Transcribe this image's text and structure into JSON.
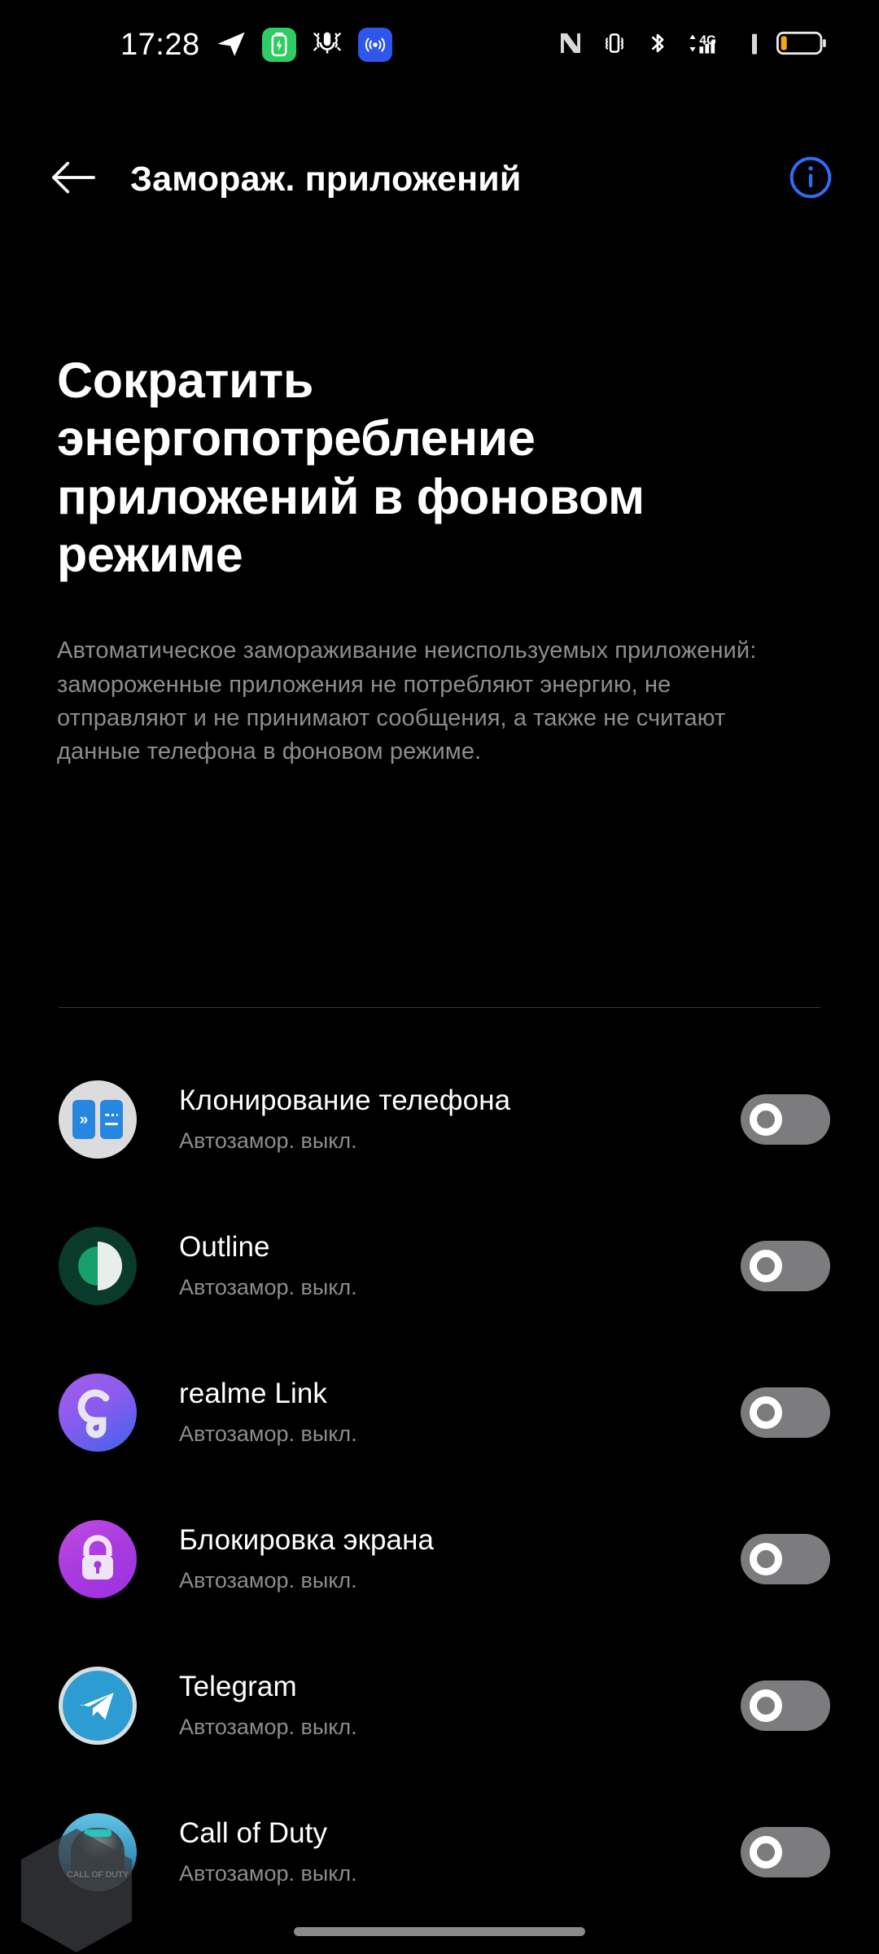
{
  "status_bar": {
    "clock": "17:28",
    "left_icons": [
      {
        "name": "telegram-icon",
        "label": "Telegram"
      },
      {
        "name": "battery-saver-icon",
        "label": "Battery saver",
        "color": "#2ecc63"
      },
      {
        "name": "mic-bug-icon",
        "label": "Microphone in use"
      },
      {
        "name": "broadcast-icon",
        "label": "Broadcast",
        "color": "#2f56ea"
      }
    ],
    "right_icons": [
      {
        "name": "nfc-icon",
        "label": "NFC"
      },
      {
        "name": "vibrate-icon",
        "label": "Vibrate"
      },
      {
        "name": "bluetooth-icon",
        "label": "Bluetooth"
      },
      {
        "name": "mobile-data-icon",
        "label": "4G"
      },
      {
        "name": "signal-bars-icon",
        "label": "Signal"
      },
      {
        "name": "battery-icon",
        "label": "Battery low",
        "color": "#f0a81e"
      }
    ],
    "network_type": "4G"
  },
  "app_bar": {
    "back_icon": "arrow-left-icon",
    "title": "Замораж. приложений",
    "info_icon": "info-circle-icon",
    "info_color": "#2f6df6"
  },
  "hero": {
    "title": "Сократить энергопотребление приложений в фоновом режиме",
    "description": "Автоматическое замораживание неиспользуемых приложений: замороженные приложения не потребляют энергию, не отправляют и не принимают сообщения, а также не считают данные телефона в фоновом режиме."
  },
  "apps": [
    {
      "name": "Клонирование телефона",
      "status": "Автозамор. выкл.",
      "icon": "phone-clone-icon",
      "toggle_on": false
    },
    {
      "name": "Outline",
      "status": "Автозамор. выкл.",
      "icon": "outline-icon",
      "toggle_on": false
    },
    {
      "name": "realme Link",
      "status": "Автозамор. выкл.",
      "icon": "realme-link-icon",
      "toggle_on": false
    },
    {
      "name": "Блокировка экрана",
      "status": "Автозамор. выкл.",
      "icon": "screen-lock-icon",
      "toggle_on": false
    },
    {
      "name": "Telegram",
      "status": "Автозамор. выкл.",
      "icon": "telegram-app-icon",
      "toggle_on": false
    },
    {
      "name": "Call of Duty",
      "status": "Автозамор. выкл.",
      "icon": "call-of-duty-icon",
      "label": "CALL OF DUTY",
      "toggle_on": false
    }
  ],
  "overlay": {
    "floating_assistant": "floating-hexagon-bubble"
  },
  "colors": {
    "background": "#000000",
    "primary_text": "#ffffff",
    "secondary_text": "#8d8d8f",
    "accent": "#2f6df6",
    "toggle_off": "#7c7c7e",
    "divider": "#3a3a3c"
  }
}
